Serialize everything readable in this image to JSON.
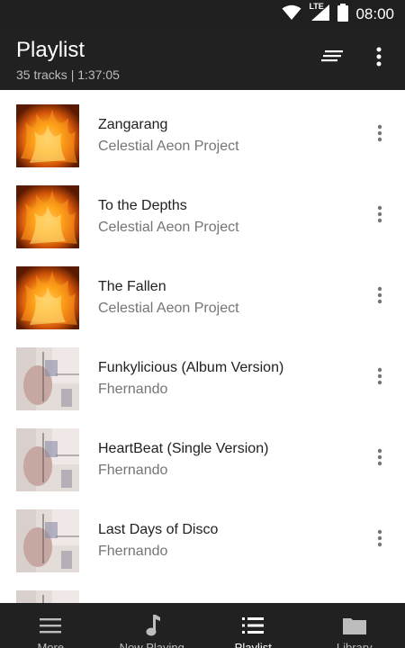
{
  "status_bar": {
    "time": "08:00",
    "network": "LTE"
  },
  "header": {
    "title": "Playlist",
    "subtitle": "35 tracks | 1:37:05"
  },
  "tracks": [
    {
      "title": "Zangarang",
      "artist": "Celestial Aeon Project",
      "art": "fire"
    },
    {
      "title": "To the Depths",
      "artist": "Celestial Aeon Project",
      "art": "fire"
    },
    {
      "title": "The Fallen",
      "artist": "Celestial Aeon Project",
      "art": "fire"
    },
    {
      "title": "Funkylicious (Album Version)",
      "artist": "Fhernando",
      "art": "collage"
    },
    {
      "title": "HeartBeat (Single Version)",
      "artist": "Fhernando",
      "art": "collage"
    },
    {
      "title": "Last Days of Disco",
      "artist": "Fhernando",
      "art": "collage"
    },
    {
      "title": "",
      "artist": "",
      "art": "collage"
    }
  ],
  "bottom_nav": [
    {
      "label": "More",
      "icon": "menu-icon"
    },
    {
      "label": "Now Playing",
      "icon": "music-note-icon"
    },
    {
      "label": "Playlist",
      "icon": "list-icon",
      "active": true
    },
    {
      "label": "Library",
      "icon": "folder-icon"
    }
  ],
  "colors": {
    "bar_bg": "#212121",
    "primary_text": "#212121",
    "secondary_text": "#757575"
  }
}
